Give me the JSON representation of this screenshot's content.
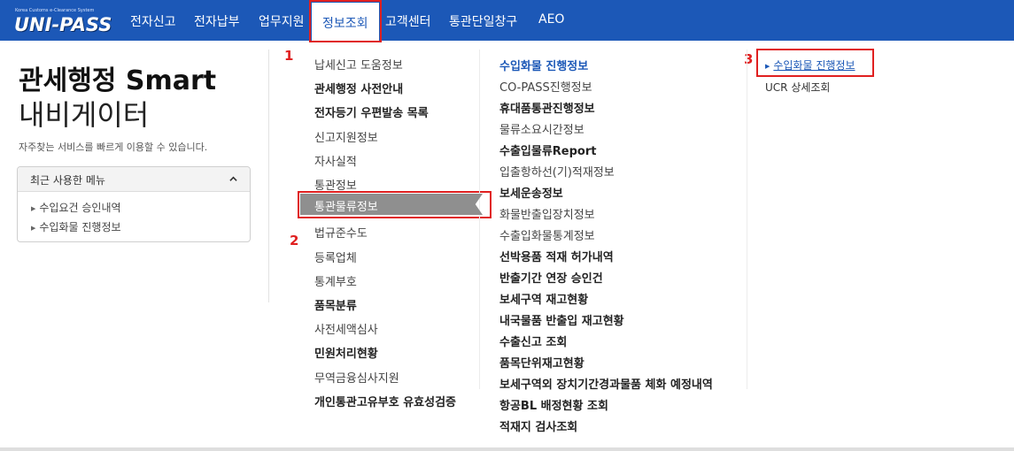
{
  "header": {
    "logo_sub": "Korea Customs e-Clearance System",
    "logo_main": "UNI-PASS",
    "nav": [
      "전자신고",
      "전자납부",
      "업무지원",
      "정보조회",
      "고객센터",
      "통관단일창구",
      "AEO"
    ],
    "active_nav_index": 3
  },
  "annotations": [
    "1",
    "2",
    "3"
  ],
  "left": {
    "title_line1": "관세행정 Smart",
    "title_line2": "내비게이터",
    "description": "자주찾는 서비스를 빠르게 이용할 수 있습니다.",
    "recent_menu_label": "최근 사용한 메뉴",
    "recent_items": [
      "수입요건 승인내역",
      "수입화물 진행정보"
    ]
  },
  "menu_col1": [
    {
      "label": "납세신고 도움정보",
      "bold": false
    },
    {
      "label": "관세행정 사전안내",
      "bold": true
    },
    {
      "label": "전자등기 우편발송 목록",
      "bold": true
    },
    {
      "label": "신고지원정보",
      "bold": false
    },
    {
      "label": "자사실적",
      "bold": false
    },
    {
      "label": "통관정보",
      "bold": false
    },
    {
      "label": "통관물류정보",
      "bold": false
    },
    {
      "label": "법규준수도",
      "bold": false
    },
    {
      "label": "등록업체",
      "bold": false
    },
    {
      "label": "통계부호",
      "bold": false
    },
    {
      "label": "품목분류",
      "bold": true
    },
    {
      "label": "사전세액심사",
      "bold": false
    },
    {
      "label": "민원처리현황",
      "bold": true
    },
    {
      "label": "무역금융심사지원",
      "bold": false
    },
    {
      "label": "개인통관고유부호 유효성검증",
      "bold": true
    }
  ],
  "selected_col1_index": 6,
  "menu_col2": [
    {
      "label": "수입화물 진행정보",
      "bold": true,
      "head": true
    },
    {
      "label": "CO-PASS진행정보",
      "bold": false
    },
    {
      "label": "휴대품통관진행정보",
      "bold": true
    },
    {
      "label": "물류소요시간정보",
      "bold": false
    },
    {
      "label": "수출입물류Report",
      "bold": true
    },
    {
      "label": "입출항하선(기)적재정보",
      "bold": false
    },
    {
      "label": "보세운송정보",
      "bold": true
    },
    {
      "label": "화물반출입장치정보",
      "bold": false
    },
    {
      "label": "수출입화물통계정보",
      "bold": false
    },
    {
      "label": "선박용품 적재 허가내역",
      "bold": true
    },
    {
      "label": "반출기간 연장 승인건",
      "bold": true
    },
    {
      "label": "보세구역 재고현황",
      "bold": true
    },
    {
      "label": "내국물품 반출입 재고현황",
      "bold": true
    },
    {
      "label": "수출신고 조회",
      "bold": true
    },
    {
      "label": "품목단위재고현황",
      "bold": true
    },
    {
      "label": "보세구역외 장치기간경과물품 체화 예정내역",
      "bold": true
    },
    {
      "label": "항공BL 배정현황 조회",
      "bold": true
    },
    {
      "label": "적재지 검사조회",
      "bold": true
    }
  ],
  "menu_col3": [
    {
      "label": "수입화물 진행정보",
      "active": true
    },
    {
      "label": "UCR 상세조회",
      "active": false
    }
  ],
  "colors": {
    "primary": "#1c58b7",
    "highlight": "#e02020",
    "selected_bg": "#8f8f8f"
  }
}
